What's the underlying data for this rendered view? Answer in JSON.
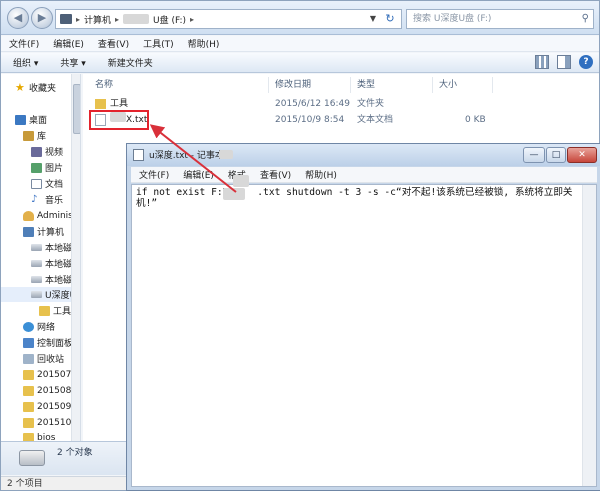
{
  "explorer": {
    "address": {
      "computer_label": "计算机",
      "drive_label": "U盘 (F:)"
    },
    "search_placeholder": "搜索 U深度U盘 (F:)",
    "menu": [
      "文件(F)",
      "编辑(E)",
      "查看(V)",
      "工具(T)",
      "帮助(H)"
    ],
    "toolbar": {
      "organize": "组织 ▾",
      "share": "共享 ▾",
      "new_folder": "新建文件夹"
    },
    "nav": {
      "favorites": "收藏夹",
      "desktop": "桌面",
      "library": "库",
      "videos": "视频",
      "pictures": "图片",
      "documents": "文档",
      "music": "音乐",
      "admin": "Adminis",
      "computer": "计算机",
      "local1": "本地磁",
      "local2": "本地磁",
      "local3": "本地磁",
      "usb": "U深度U",
      "tools": "工具",
      "network": "网络",
      "control_panel": "控制面板",
      "recycle": "回收站",
      "f201507": "201507",
      "f201508": "201508",
      "f201509": "201509",
      "f201510": "201510",
      "bios": "bios"
    },
    "columns": {
      "name": "名称",
      "modified": "修改日期",
      "type": "类型",
      "size": "大小"
    },
    "files": [
      {
        "name": "工具",
        "modified": "2015/6/12 16:49",
        "type": "文件夹",
        "size": ""
      },
      {
        "name": "X.txt",
        "modified": "2015/10/9 8:54",
        "type": "文本文档",
        "size": "0 KB"
      }
    ],
    "status_count": "2 个对象",
    "bottom_status": "2 个项目"
  },
  "notepad": {
    "title": "u深度.txt - 记事本",
    "menu": [
      "文件(F)",
      "编辑(E)",
      "格式",
      "查看(V)",
      "帮助(H)"
    ],
    "content": "if not exist F:\\u    .txt shutdown -t 3 -s -c“对不起!该系统已经被锁, 系统将立即关机!”"
  },
  "colors": {
    "highlight_box": "#e3232d",
    "arrow": "#d9303a"
  }
}
